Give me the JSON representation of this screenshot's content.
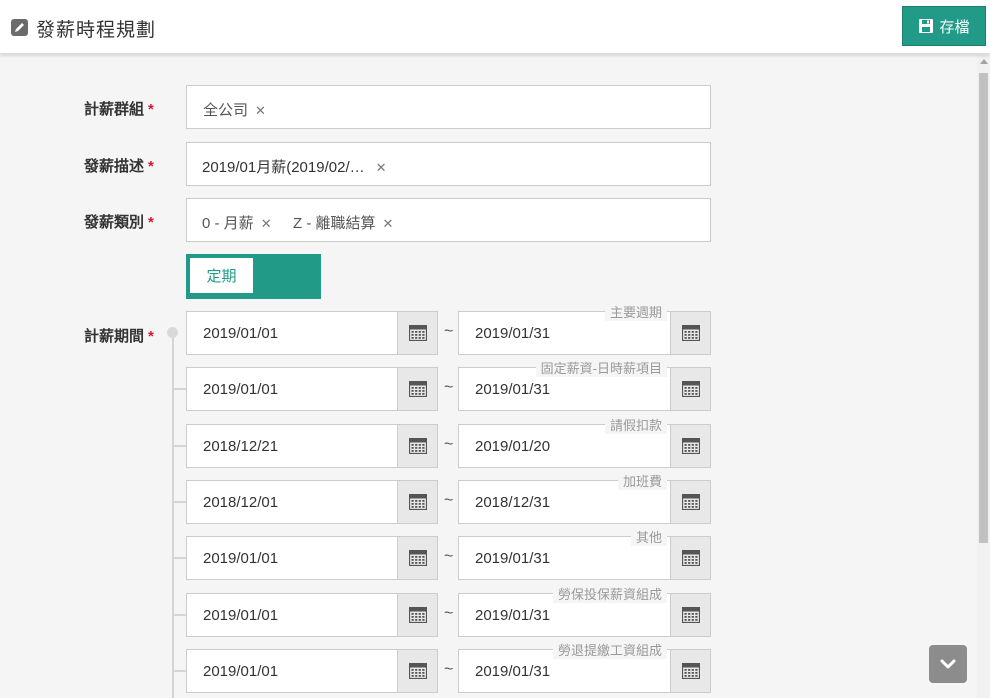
{
  "header": {
    "title": "發薪時程規劃",
    "save_label": "存檔"
  },
  "form": {
    "group": {
      "label": "計薪群組",
      "required": "*",
      "tags": [
        {
          "text": "全公司"
        }
      ]
    },
    "description": {
      "label": "發薪描述",
      "required": "*",
      "tags": [
        {
          "text": "2019/01月薪(2019/02/…"
        }
      ]
    },
    "category": {
      "label": "發薪類別",
      "required": "*",
      "tags": [
        {
          "text": "0 - 月薪"
        },
        {
          "text": "Z - 離職結算"
        }
      ]
    },
    "toggle": {
      "label": "定期",
      "on": true
    },
    "period": {
      "label": "計薪期間",
      "required": "*",
      "separator": "~",
      "rows": [
        {
          "name": "主要週期",
          "start": "2019/01/01",
          "end": "2019/01/31"
        },
        {
          "name": "固定薪資-日時薪項目",
          "start": "2019/01/01",
          "end": "2019/01/31"
        },
        {
          "name": "請假扣款",
          "start": "2018/12/21",
          "end": "2019/01/20"
        },
        {
          "name": "加班費",
          "start": "2018/12/01",
          "end": "2018/12/31"
        },
        {
          "name": "其他",
          "start": "2019/01/01",
          "end": "2019/01/31"
        },
        {
          "name": "勞保投保薪資組成",
          "start": "2019/01/01",
          "end": "2019/01/31"
        },
        {
          "name": "勞退提繳工資組成",
          "start": "2019/01/01",
          "end": "2019/01/31"
        }
      ]
    }
  },
  "colors": {
    "accent": "#219a88",
    "required": "#d0173b"
  },
  "icons": {
    "header": "pencil-icon",
    "save": "floppy-disk-icon",
    "date": "calendar-icon",
    "remove": "close-icon",
    "scroll": "chevron-down-icon"
  }
}
